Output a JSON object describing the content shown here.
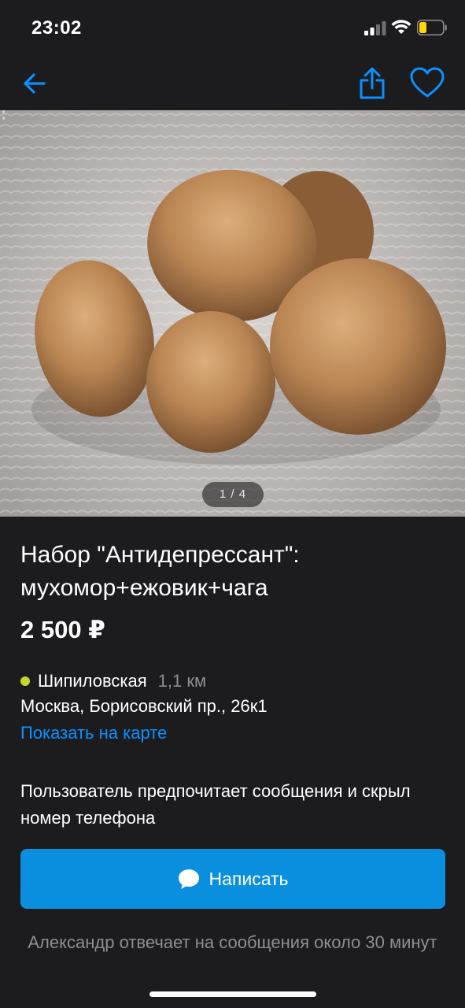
{
  "status_bar": {
    "time": "23:02"
  },
  "nav": {
    "back_icon": "arrow-left-icon",
    "share_icon": "share-icon",
    "favorite_icon": "heart-icon",
    "accent_color": "#0a91ff"
  },
  "gallery": {
    "counter": "1 / 4"
  },
  "listing": {
    "title": "Набор \"Антидепрессант\": мухомор+ежовик+чага",
    "price": "2 500 ₽"
  },
  "location": {
    "metro": "Шипиловская",
    "distance": "1,1 км",
    "metro_color": "#c5d82f",
    "address": "Москва, Борисовский пр., 26к1",
    "map_link": "Показать на карте"
  },
  "contact": {
    "preference": "Пользователь предпочитает сообщения и скрыл номер телефона",
    "write_button": "Написать",
    "write_icon": "chat-bubble-icon",
    "button_color": "#0a8fdf",
    "reply_note": "Александр отвечает на сообщения около 30 минут"
  }
}
